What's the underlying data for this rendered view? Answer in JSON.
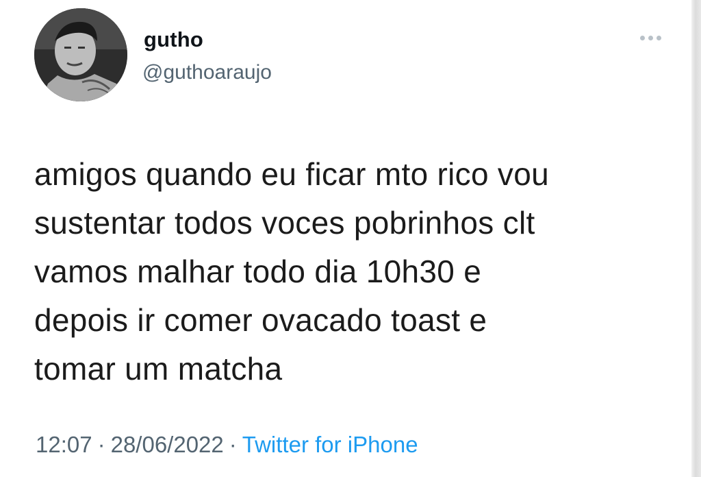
{
  "author": {
    "display_name": "gutho",
    "handle": "@guthoaraujo"
  },
  "tweet": {
    "lines": [
      "amigos quando eu ficar mto rico vou",
      "sustentar todos voces pobrinhos clt",
      "vamos malhar todo dia 10h30 e",
      "depois ir comer ovacado toast e",
      "tomar um matcha"
    ]
  },
  "meta": {
    "time": "12:07",
    "separator": "·",
    "date": "28/06/2022",
    "source": "Twitter for iPhone"
  },
  "icons": {
    "more": "more-options-icon"
  },
  "colors": {
    "link": "#1d9bf0",
    "secondary_text": "#536471",
    "primary_text": "#0f1419"
  }
}
